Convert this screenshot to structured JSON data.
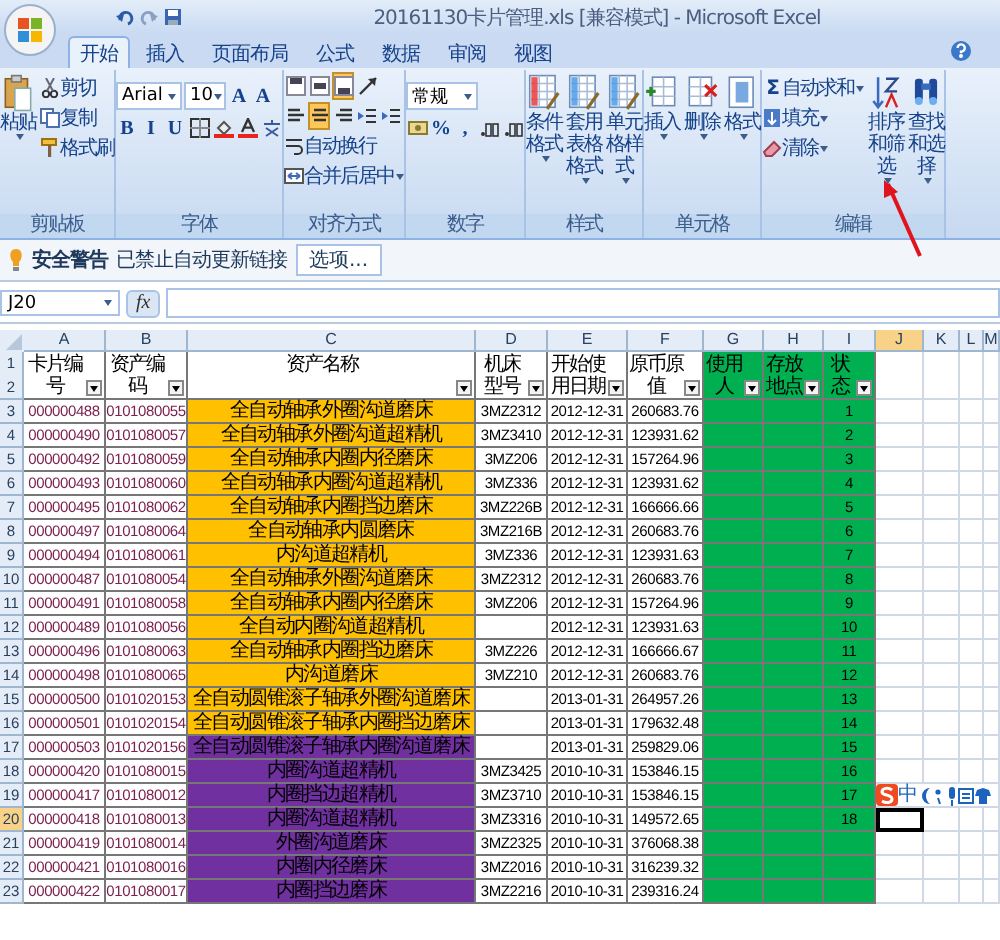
{
  "title_bar": {
    "title": "20161130卡片管理.xls  [兼容模式] - Microsoft Excel"
  },
  "tabs": [
    {
      "label": "开始",
      "selected": true
    },
    {
      "label": "插入",
      "selected": false
    },
    {
      "label": "页面布局",
      "selected": false
    },
    {
      "label": "公式",
      "selected": false
    },
    {
      "label": "数据",
      "selected": false
    },
    {
      "label": "审阅",
      "selected": false
    },
    {
      "label": "视图",
      "selected": false
    }
  ],
  "ribbon": {
    "groups": [
      {
        "label": "剪贴板",
        "items": [
          {
            "kind": "paste",
            "label": "粘贴",
            "menu": true
          },
          {
            "kind": "cut",
            "label": "剪切"
          },
          {
            "kind": "copy",
            "label": "复制"
          },
          {
            "kind": "brush",
            "label": "格式刷"
          }
        ]
      },
      {
        "label": "字体",
        "rows": [
          {
            "items": [
              {
                "kind": "dropdown",
                "value": "Arial"
              },
              {
                "kind": "dropdown",
                "value": "10"
              },
              {
                "kind": "glyph",
                "label": "A"
              },
              {
                "kind": "glyph",
                "label": "A"
              }
            ]
          },
          {
            "items": [
              {
                "kind": "glyph",
                "label": "B"
              },
              {
                "kind": "glyph",
                "label": "I"
              },
              {
                "kind": "glyph",
                "label": "U"
              },
              {
                "kind": "border"
              },
              {
                "kind": "fill"
              },
              {
                "kind": "fontcolor"
              },
              {
                "kind": "phonetic"
              }
            ]
          }
        ]
      },
      {
        "label": "对齐方式",
        "rows": [
          {
            "items": [
              {
                "kind": "valign",
                "selected": false
              },
              {
                "kind": "valign",
                "selected": false
              },
              {
                "kind": "valign",
                "selected": true
              },
              {
                "kind": "orient"
              }
            ]
          },
          {
            "items": [
              {
                "kind": "halign",
                "selected": false
              },
              {
                "kind": "halign",
                "selected": true
              },
              {
                "kind": "halign",
                "selected": false
              },
              {
                "kind": "indent"
              },
              {
                "kind": "indent"
              }
            ]
          },
          {
            "items": [
              {
                "kind": "wrap",
                "label": "自动换行"
              }
            ]
          },
          {
            "items": [
              {
                "kind": "merge",
                "label": "合并后居中",
                "menu": true
              }
            ]
          }
        ]
      },
      {
        "label": "数字",
        "rows": [
          {
            "items": [
              {
                "kind": "dropdown",
                "value": "常规"
              }
            ]
          },
          {
            "items": [
              {
                "kind": "currency"
              },
              {
                "kind": "glyph",
                "label": "%"
              },
              {
                "kind": "glyph",
                "label": ","
              },
              {
                "kind": "decimal"
              },
              {
                "kind": "decimal"
              }
            ]
          }
        ]
      },
      {
        "label": "样式",
        "items": [
          {
            "kind": "large",
            "label": "条件格式",
            "menu": true
          },
          {
            "kind": "large",
            "label": "套用表格格式",
            "menu": true
          },
          {
            "kind": "large",
            "label": "单元格样式",
            "menu": true
          }
        ]
      },
      {
        "label": "单元格",
        "items": [
          {
            "kind": "insert",
            "label": "插入",
            "menu": true
          },
          {
            "kind": "delete",
            "label": "删除",
            "menu": true
          },
          {
            "kind": "format",
            "label": "格式",
            "menu": true
          }
        ]
      },
      {
        "label": "编辑",
        "items": [
          {
            "kind": "sum",
            "glyph": "Σ",
            "label": "自动求和",
            "menu": true
          },
          {
            "kind": "filldown",
            "label": "填充",
            "menu": true
          },
          {
            "kind": "clear",
            "label": "清除",
            "menu": true
          },
          {
            "kind": "sort",
            "label": "排序和筛选",
            "menu": true
          },
          {
            "kind": "find",
            "label": "查找和选择",
            "menu": true
          }
        ]
      }
    ]
  },
  "security_bar": {
    "title": "安全警告",
    "message": "已禁止自动更新链接",
    "button": "选项..."
  },
  "formula_bar": {
    "name_box": "J20",
    "function_label": "fx"
  },
  "sheet": {
    "column_letters": [
      {
        "label": "A",
        "selected": false
      },
      {
        "label": "B",
        "selected": false
      },
      {
        "label": "C",
        "selected": false
      },
      {
        "label": "D",
        "selected": false
      },
      {
        "label": "E",
        "selected": false
      },
      {
        "label": "F",
        "selected": false
      },
      {
        "label": "G",
        "selected": false
      },
      {
        "label": "H",
        "selected": false
      },
      {
        "label": "I",
        "selected": false
      },
      {
        "label": "J",
        "selected": true
      },
      {
        "label": "K",
        "selected": false
      },
      {
        "label": "L",
        "selected": false
      },
      {
        "label": "M",
        "selected": false
      }
    ],
    "header_row_numbers": [
      "1",
      "2"
    ],
    "headers": [
      {
        "text": "卡片编号",
        "filter": true
      },
      {
        "text": "资产编码",
        "filter": true
      },
      {
        "text": "资产名称",
        "filter": true
      },
      {
        "text": "机床型号",
        "filter": true
      },
      {
        "text": "开始使用日期",
        "filter": true
      },
      {
        "text": "原币原值",
        "filter": true
      },
      {
        "text": "使用人",
        "filter": true,
        "color": "#00b050"
      },
      {
        "text": "存放地点",
        "filter": true,
        "color": "#00b050"
      },
      {
        "text": "状态",
        "filter": true,
        "color": "#00b050"
      }
    ],
    "rows": [
      {
        "number": "3",
        "selected": false,
        "color": "#ffc000",
        "cells": [
          "000000488",
          "0101080055",
          "全自动轴承外圈沟道磨床",
          "3MZ2312",
          "2012-12-31",
          "260683.76",
          "",
          "",
          "1"
        ]
      },
      {
        "number": "4",
        "selected": false,
        "color": "#ffc000",
        "cells": [
          "000000490",
          "0101080057",
          "全自动轴承外圈沟道超精机",
          "3MZ3410",
          "2012-12-31",
          "123931.62",
          "",
          "",
          "2"
        ]
      },
      {
        "number": "5",
        "selected": false,
        "color": "#ffc000",
        "cells": [
          "000000492",
          "0101080059",
          "全自动轴承内圈内径磨床",
          "3MZ206",
          "2012-12-31",
          "157264.96",
          "",
          "",
          "3"
        ]
      },
      {
        "number": "6",
        "selected": false,
        "color": "#ffc000",
        "cells": [
          "000000493",
          "0101080060",
          "全自动轴承内圈沟道超精机",
          "3MZ336",
          "2012-12-31",
          "123931.62",
          "",
          "",
          "4"
        ]
      },
      {
        "number": "7",
        "selected": false,
        "color": "#ffc000",
        "cells": [
          "000000495",
          "0101080062",
          "全自动轴承内圈挡边磨床",
          "3MZ226B",
          "2012-12-31",
          "166666.66",
          "",
          "",
          "5"
        ]
      },
      {
        "number": "8",
        "selected": false,
        "color": "#ffc000",
        "cells": [
          "000000497",
          "0101080064",
          "全自动轴承内圆磨床",
          "3MZ216B",
          "2012-12-31",
          "260683.76",
          "",
          "",
          "6"
        ]
      },
      {
        "number": "9",
        "selected": false,
        "color": "#ffc000",
        "cells": [
          "000000494",
          "0101080061",
          "内沟道超精机",
          "3MZ336",
          "2012-12-31",
          "123931.63",
          "",
          "",
          "7"
        ]
      },
      {
        "number": "10",
        "selected": false,
        "color": "#ffc000",
        "cells": [
          "000000487",
          "0101080054",
          "全自动轴承外圈沟道磨床",
          "3MZ2312",
          "2012-12-31",
          "260683.76",
          "",
          "",
          "8"
        ]
      },
      {
        "number": "11",
        "selected": false,
        "color": "#ffc000",
        "cells": [
          "000000491",
          "0101080058",
          "全自动轴承内圈内径磨床",
          "3MZ206",
          "2012-12-31",
          "157264.96",
          "",
          "",
          "9"
        ]
      },
      {
        "number": "12",
        "selected": false,
        "color": "#ffc000",
        "cells": [
          "000000489",
          "0101080056",
          "全自动内圈沟道超精机",
          "",
          "2012-12-31",
          "123931.63",
          "",
          "",
          "10"
        ]
      },
      {
        "number": "13",
        "selected": false,
        "color": "#ffc000",
        "cells": [
          "000000496",
          "0101080063",
          "全自动轴承内圈挡边磨床",
          "3MZ226",
          "2012-12-31",
          "166666.67",
          "",
          "",
          "11"
        ]
      },
      {
        "number": "14",
        "selected": false,
        "color": "#ffc000",
        "cells": [
          "000000498",
          "0101080065",
          "内沟道磨床",
          "3MZ210",
          "2012-12-31",
          "260683.76",
          "",
          "",
          "12"
        ]
      },
      {
        "number": "15",
        "selected": false,
        "color": "#ffc000",
        "cells": [
          "000000500",
          "0101020153",
          "全自动圆锥滚子轴承外圈沟道磨床",
          "",
          "2013-01-31",
          "264957.26",
          "",
          "",
          "13"
        ]
      },
      {
        "number": "16",
        "selected": false,
        "color": "#ffc000",
        "cells": [
          "000000501",
          "0101020154",
          "全自动圆锥滚子轴承内圈挡边磨床",
          "",
          "2013-01-31",
          "179632.48",
          "",
          "",
          "14"
        ]
      },
      {
        "number": "17",
        "selected": false,
        "color": "#7030a0",
        "cells": [
          "000000503",
          "0101020156",
          "全自动圆锥滚子轴承内圈沟道磨床",
          "",
          "2013-01-31",
          "259829.06",
          "",
          "",
          "15"
        ]
      },
      {
        "number": "18",
        "selected": false,
        "color": "#7030a0",
        "cells": [
          "000000420",
          "0101080015",
          "内圈沟道超精机",
          "3MZ3425",
          "2010-10-31",
          "153846.15",
          "",
          "",
          "16"
        ]
      },
      {
        "number": "19",
        "selected": false,
        "color": "#7030a0",
        "cells": [
          "000000417",
          "0101080012",
          "内圈挡边超精机",
          "3MZ3710",
          "2010-10-31",
          "153846.15",
          "",
          "",
          "17"
        ],
        "ime_toolbar": {
          "mode": "中"
        }
      },
      {
        "number": "20",
        "selected": true,
        "color": "#7030a0",
        "cells": [
          "000000418",
          "0101080013",
          "内圈沟道超精机",
          "3MZ3316",
          "2010-10-31",
          "149572.65",
          "",
          "",
          "18"
        ]
      },
      {
        "number": "21",
        "selected": false,
        "color": "#7030a0",
        "cells": [
          "000000419",
          "0101080014",
          "外圈沟道磨床",
          "3MZ2325",
          "2010-10-31",
          "376068.38",
          "",
          "",
          ""
        ]
      },
      {
        "number": "22",
        "selected": false,
        "color": "#7030a0",
        "cells": [
          "000000421",
          "0101080016",
          "内圈内径磨床",
          "3MZ2016",
          "2010-10-31",
          "316239.32",
          "",
          "",
          ""
        ]
      },
      {
        "number": "23",
        "selected": false,
        "color": "#7030a0",
        "cells": [
          "000000422",
          "0101080017",
          "内圈挡边磨床",
          "3MZ2216",
          "2010-10-31",
          "239316.24",
          "",
          "",
          ""
        ]
      }
    ]
  },
  "annotation": {
    "kind": "arrow"
  }
}
